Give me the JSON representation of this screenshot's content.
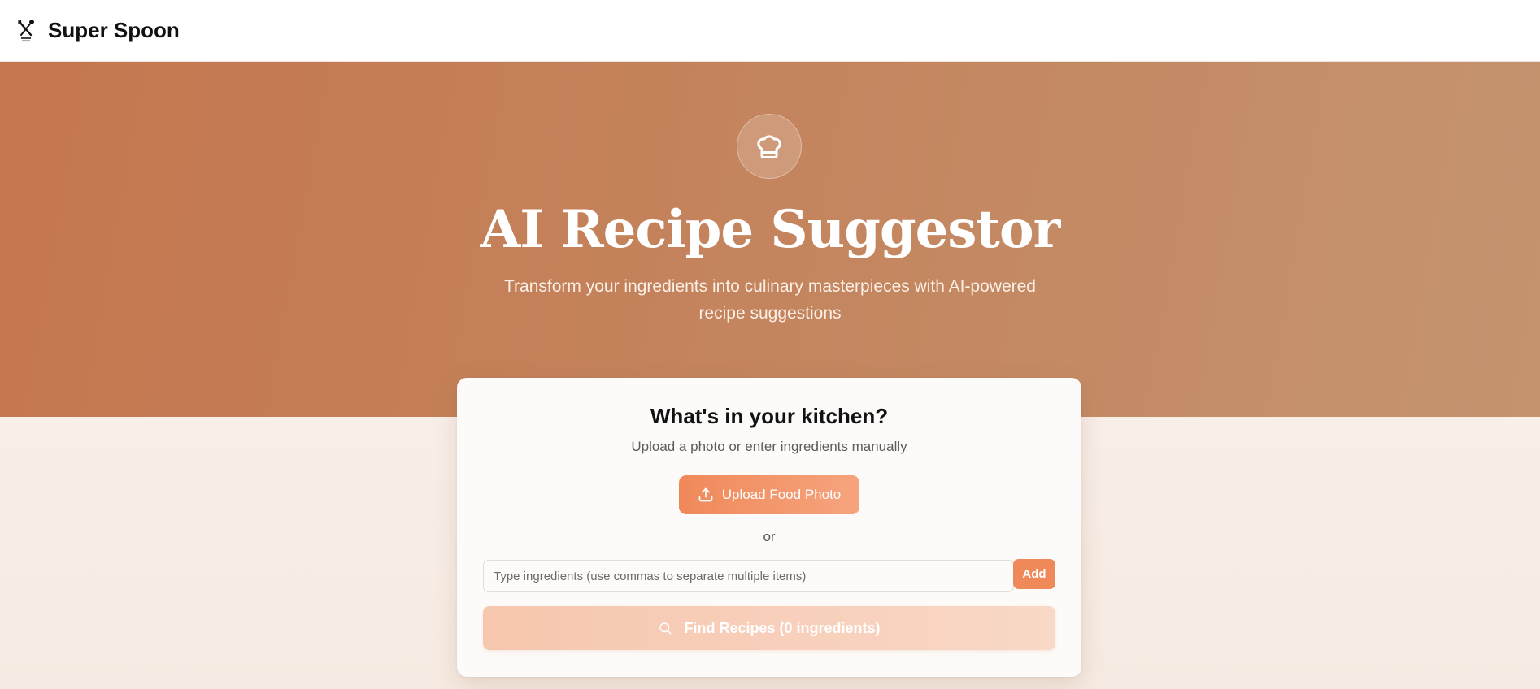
{
  "header": {
    "brand_name": "Super Spoon",
    "logo_icon": "spoon-fork-chef-logo"
  },
  "hero": {
    "icon": "chef-hat-icon",
    "title": "AI Recipe Suggestor",
    "subtitle": "Transform your ingredients into culinary masterpieces with AI-powered recipe suggestions"
  },
  "card": {
    "title": "What's in your kitchen?",
    "subtitle": "Upload a photo or enter ingredients manually",
    "upload_button": "Upload Food Photo",
    "upload_icon": "upload-icon",
    "or_text": "or",
    "input_placeholder": "Type ingredients (use commas to separate multiple items)",
    "input_value": "",
    "add_button": "Add",
    "find_button": "Find Recipes (0 ingredients)",
    "find_icon": "search-icon"
  },
  "colors": {
    "accent": "#f0895a",
    "hero_start": "#c5774f",
    "hero_end": "#c4946f"
  }
}
